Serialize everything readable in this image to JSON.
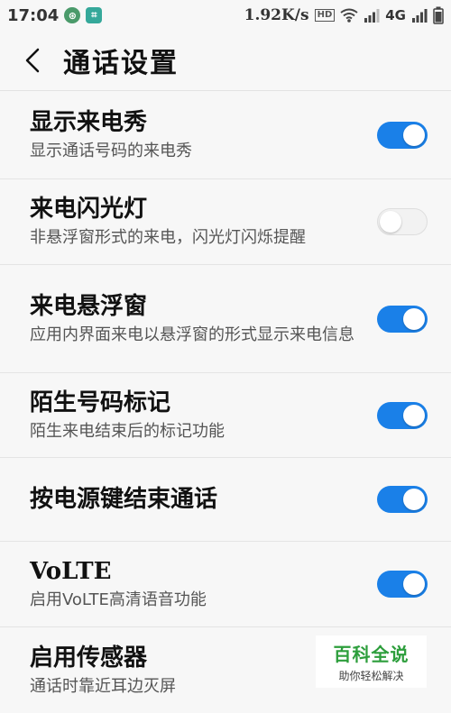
{
  "status_bar": {
    "time": "17:04",
    "speed": "1.92K/s",
    "hd": "HD",
    "network": "4G"
  },
  "header": {
    "title": "通话设置"
  },
  "settings": [
    {
      "title": "显示来电秀",
      "desc": "显示通话号码的来电秀",
      "on": true
    },
    {
      "title": "来电闪光灯",
      "desc": "非悬浮窗形式的来电，闪光灯闪烁提醒",
      "on": false
    },
    {
      "title": "来电悬浮窗",
      "desc": "应用内界面来电以悬浮窗的形式显示来电信息",
      "on": true
    },
    {
      "title": "陌生号码标记",
      "desc": "陌生来电结束后的标记功能",
      "on": true
    },
    {
      "title": "按电源键结束通话",
      "desc": "",
      "on": true
    },
    {
      "title": "VoLTE",
      "desc": "启用VoLTE高清语音功能",
      "on": true
    },
    {
      "title": "启用传感器",
      "desc": "通话时靠近耳边灭屏"
    }
  ],
  "watermark": {
    "main": "百科全说",
    "sub": "助你轻松解决"
  },
  "colors": {
    "accent": "#1a80e8",
    "background": "#f7f7f7"
  }
}
